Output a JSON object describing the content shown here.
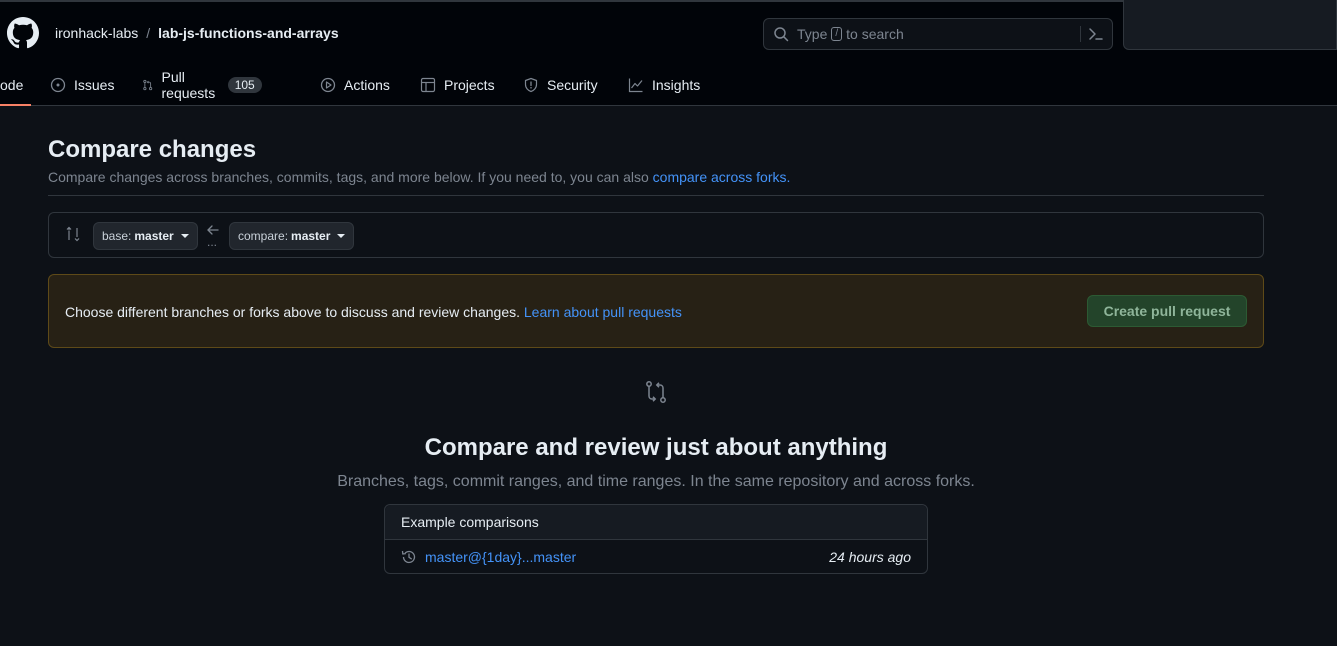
{
  "header": {
    "owner": "ironhack-labs",
    "separator": "/",
    "repo": "lab-js-functions-and-arrays",
    "search": {
      "prefix": "Type",
      "key": "/",
      "suffix": "to search"
    }
  },
  "nav": {
    "items": [
      {
        "label": "Code",
        "visible_label": "ode",
        "icon": "code-icon",
        "active": true
      },
      {
        "label": "Issues",
        "icon": "issue-opened-icon"
      },
      {
        "label": "Pull requests",
        "icon": "git-pull-request-icon",
        "counter": "105"
      },
      {
        "label": "Actions",
        "icon": "play-icon"
      },
      {
        "label": "Projects",
        "icon": "table-icon"
      },
      {
        "label": "Security",
        "icon": "shield-icon"
      },
      {
        "label": "Insights",
        "icon": "graph-icon"
      }
    ]
  },
  "main": {
    "title": "Compare changes",
    "subtitle": "Compare changes across branches, commits, tags, and more below. If you need to, you can also",
    "subtitle_link": "compare across forks.",
    "base": {
      "label": "base:",
      "value": "master"
    },
    "compare": {
      "label": "compare:",
      "value": "master"
    },
    "range_dots": "...",
    "flash": {
      "text": "Choose different branches or forks above to discuss and review changes.",
      "link": "Learn about pull requests",
      "button": "Create pull request"
    },
    "blankslate": {
      "title": "Compare and review just about anything",
      "subtitle": "Branches, tags, commit ranges, and time ranges. In the same repository and across forks."
    },
    "examples": {
      "header": "Example comparisons",
      "rows": [
        {
          "link": "master@{1day}...master",
          "time": "24 hours ago"
        }
      ]
    }
  },
  "colors": {
    "background": "#0d1117",
    "link": "#4493f8",
    "active_underline": "#f78166",
    "flash_bg": "#272115",
    "primary_button": "#23442a"
  }
}
